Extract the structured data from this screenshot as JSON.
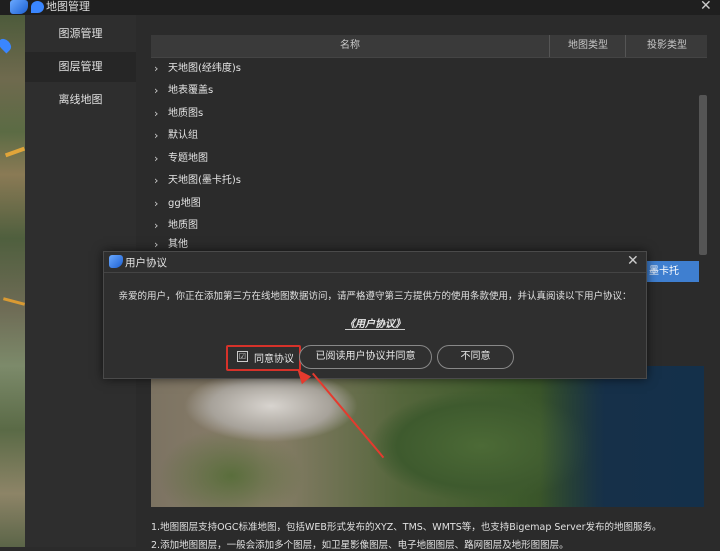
{
  "window": {
    "title": "地图管理",
    "close_glyph": "✕"
  },
  "sidebar": {
    "items": [
      {
        "label": "图源管理"
      },
      {
        "label": "图层管理"
      },
      {
        "label": "离线地图"
      }
    ]
  },
  "table": {
    "columns": [
      "名称",
      "地图类型",
      "投影类型"
    ],
    "rows": [
      {
        "label": "天地图(经纬度)s"
      },
      {
        "label": "地表覆盖s"
      },
      {
        "label": "地质图s"
      },
      {
        "label": "默认组"
      },
      {
        "label": "专题地图"
      },
      {
        "label": "天地图(墨卡托)s"
      },
      {
        "label": "gg地图"
      },
      {
        "label": "地质图"
      },
      {
        "label": "其他"
      }
    ],
    "selected_cell": "墨卡托",
    "chevron": "›"
  },
  "notes": {
    "line1": "1.地图图层支持OGC标准地图，包括WEB形式发布的XYZ、TMS、WMTS等，也支持Bigemap Server发布的地图服务。",
    "line2": "2.添加地图图层，一般会添加多个图层，如卫星影像图层、电子地图图层、路网图层及地形图图层。"
  },
  "dialog": {
    "title": "用户协议",
    "close_glyph": "✕",
    "message": "亲爱的用户，你正在添加第三方在线地图数据访问，请严格遵守第三方提供方的使用条款使用，并认真阅读以下用户协议：",
    "agreement_link": "《用户协议》",
    "agree_checkbox_label": "同意协议",
    "checkbox_glyph": "☑",
    "read_agree_button": "已阅读用户协议并同意",
    "disagree_button": "不同意"
  },
  "colors": {
    "highlight_box": "#d6322a",
    "selected_row": "#3f7fd0",
    "brand": "#3a86ff"
  }
}
